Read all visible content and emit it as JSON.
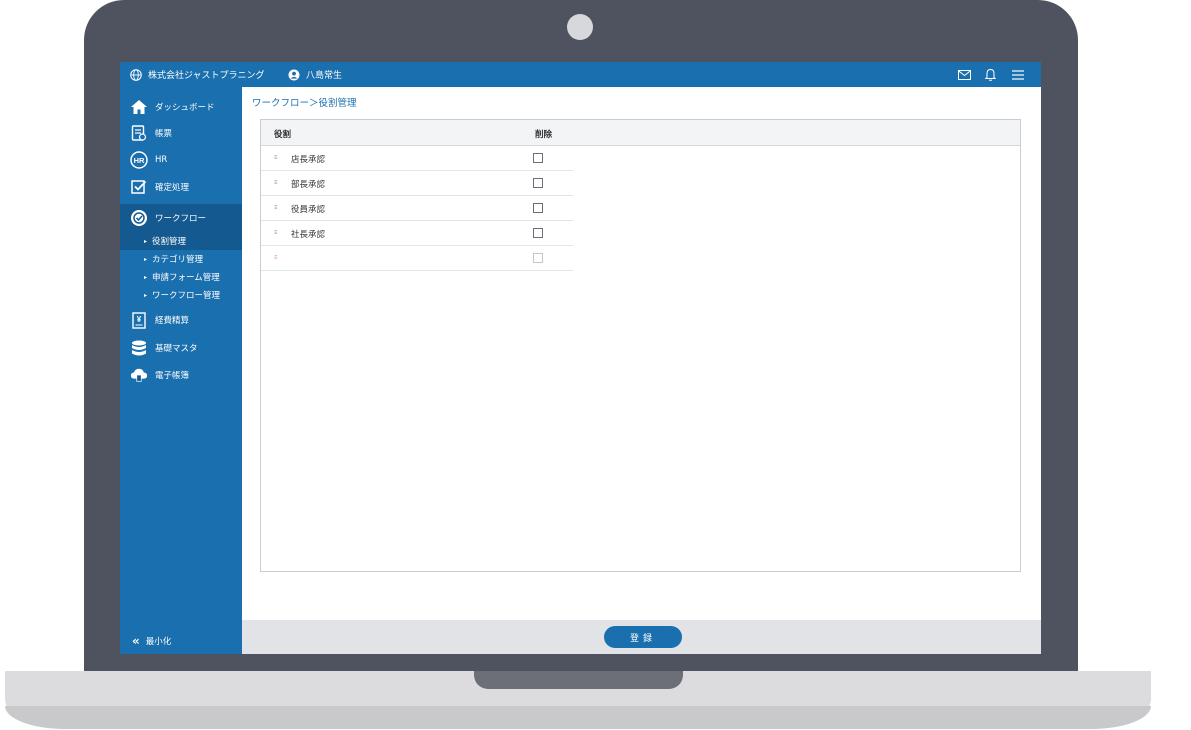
{
  "header": {
    "company": "株式会社ジャストプラニング",
    "user": "八島常生"
  },
  "sidebar": {
    "items": [
      {
        "label": "ダッシュボード",
        "icon": "home-icon"
      },
      {
        "label": "帳票",
        "icon": "document-icon"
      },
      {
        "label": "HR",
        "icon": "hr-icon"
      },
      {
        "label": "確定処理",
        "icon": "checkbox-icon"
      },
      {
        "label": "ワークフロー",
        "icon": "workflow-icon"
      },
      {
        "label": "経費精算",
        "icon": "yen-receipt-icon"
      },
      {
        "label": "基礎マスタ",
        "icon": "database-icon"
      },
      {
        "label": "電子帳簿",
        "icon": "cloud-icon"
      }
    ],
    "workflow_sub": [
      {
        "label": "役割管理"
      },
      {
        "label": "カテゴリ管理"
      },
      {
        "label": "申請フォーム管理"
      },
      {
        "label": "ワークフロー管理"
      }
    ],
    "minimize": "最小化"
  },
  "main": {
    "breadcrumb": "ワークフロー＞役割管理",
    "table": {
      "headers": [
        "役割",
        "削除"
      ],
      "rows": [
        {
          "role": "店長承認",
          "delete": false
        },
        {
          "role": "部長承認",
          "delete": false
        },
        {
          "role": "役員承認",
          "delete": false
        },
        {
          "role": "社長承認",
          "delete": false
        },
        {
          "role": "",
          "delete": false
        }
      ]
    },
    "register_label": "登録"
  },
  "colors": {
    "brand": "#1a6fae",
    "sidebar_active": "#145a90",
    "footer": "#e2e3e6"
  }
}
